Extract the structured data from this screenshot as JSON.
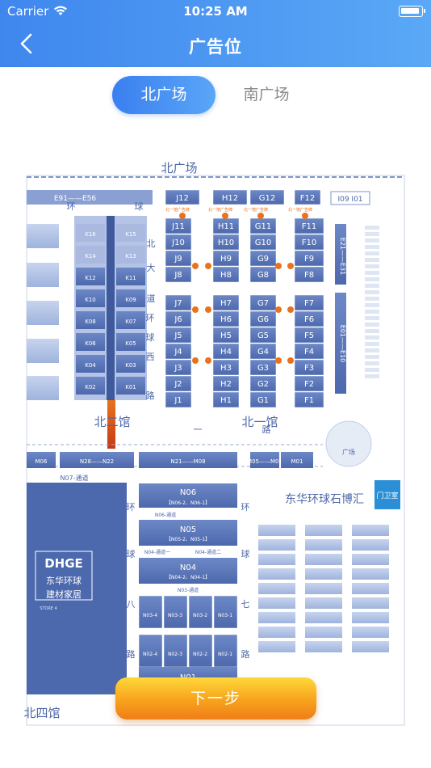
{
  "status_bar": {
    "carrier": "Carrier",
    "time": "10:25 AM"
  },
  "nav": {
    "title": "广告位",
    "back_icon": "chevron-left-icon"
  },
  "tabs": [
    {
      "label": "北广场",
      "active": true
    },
    {
      "label": "南广场",
      "active": false
    }
  ],
  "map": {
    "north_plaza_label": "北广场",
    "top_left_strip": "E91——E56",
    "top_right_booth": "I09 I01",
    "rows_J": [
      "J12",
      "J11",
      "J10",
      "J9",
      "J8",
      "J7",
      "J6",
      "J5",
      "J4",
      "J3",
      "J2",
      "J1"
    ],
    "rows_H": [
      "H12",
      "H11",
      "H10",
      "H9",
      "H8",
      "H7",
      "H6",
      "H5",
      "H4",
      "H3",
      "H2",
      "H1"
    ],
    "rows_G": [
      "G12",
      "G11",
      "G10",
      "G9",
      "G8",
      "G7",
      "G6",
      "G5",
      "G4",
      "G3",
      "G2",
      "G1"
    ],
    "rows_F": [
      "F12",
      "F11",
      "F10",
      "F9",
      "F8",
      "F7",
      "F6",
      "F5",
      "F4",
      "F3",
      "F2",
      "F1"
    ],
    "rows_K_left": [
      "K16",
      "K14",
      "K12",
      "K10",
      "K08",
      "K06",
      "K04",
      "K02"
    ],
    "rows_K_right": [
      "K15",
      "K13",
      "K11",
      "K09",
      "K07",
      "K05",
      "K03",
      "K01"
    ],
    "column_E21_E31": "E21——E31",
    "column_E01_E10": "E01——E10",
    "bei_yi_guan": "北一馆",
    "bei_er_guan": "北二馆",
    "bei_si_guan": "北四馆",
    "road_chars": [
      "环",
      "球",
      "一",
      "路",
      "北",
      "大",
      "道",
      "环",
      "球",
      "西",
      "路",
      "环",
      "球",
      "八",
      "路",
      "环",
      "球",
      "七",
      "路"
    ],
    "plaza_label": "广场",
    "plaza_right_label": "东华环球石博汇",
    "guard_label": "门卫室",
    "m_row": [
      "M06",
      "N28——N22",
      "N21——M08",
      "M05——M02",
      "M01"
    ],
    "n07_label": "N07-通道",
    "n06": {
      "title": "N06",
      "sub": "【N06-2、N06-1】",
      "road": "N06-通道"
    },
    "n05": {
      "title": "N05",
      "sub": "【N05-2、N05-1】"
    },
    "n04_roads": [
      "N04-通道一",
      "N04-通道二"
    ],
    "n04": {
      "title": "N04",
      "sub": "【N04-2、N04-1】"
    },
    "n03_road": "N03-通道",
    "n03": {
      "title": "N03",
      "cells": [
        "N03-4",
        "N03-3",
        "N03-2",
        "N03-1"
      ]
    },
    "n02": {
      "title": "N02",
      "cells": [
        "N02-4",
        "N02-3",
        "N02-2",
        "N02-1"
      ]
    },
    "n01": {
      "title": "N01"
    },
    "dhge": {
      "title": "DHGE",
      "line1": "东华环球",
      "line2": "建材家居",
      "caption": "STORE 4"
    },
    "ad_tags": [
      "北一馆广告牌",
      "北一馆广告牌",
      "北一馆广告牌",
      "北一馆广告牌"
    ]
  },
  "next_button": {
    "label": "下一步"
  }
}
